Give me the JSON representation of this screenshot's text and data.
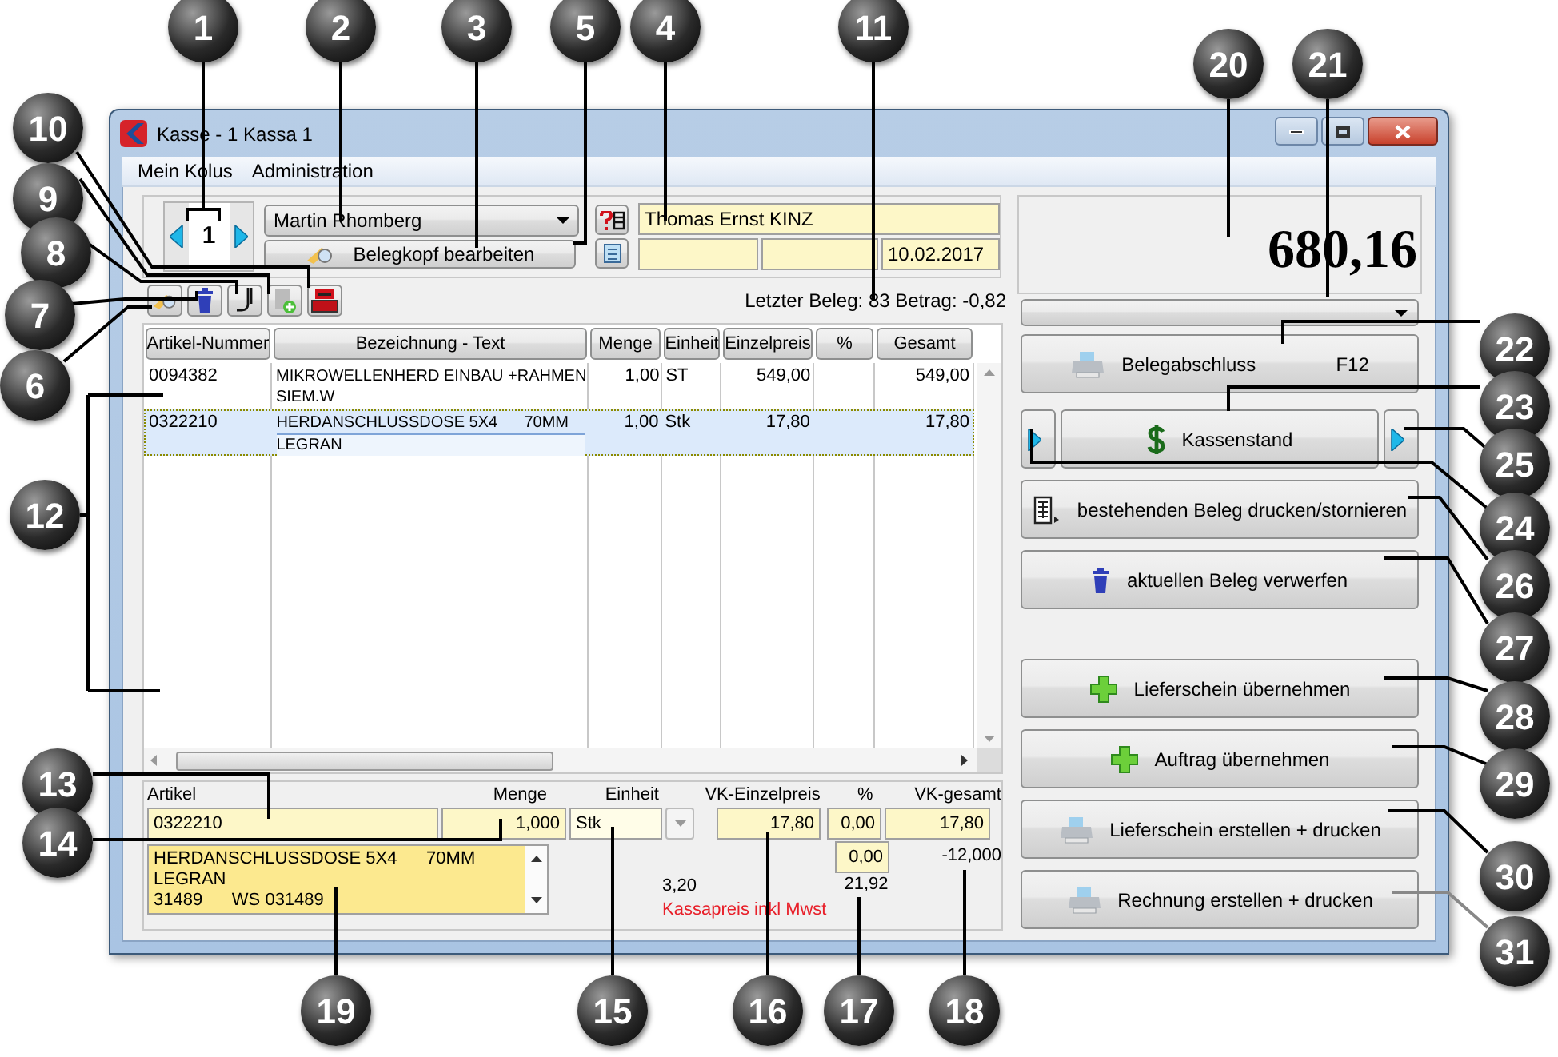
{
  "window": {
    "title": "Kasse - 1 Kassa 1"
  },
  "menu": [
    "Mein Kolus",
    "Administration"
  ],
  "header": {
    "page_number": "1",
    "salesperson": "Martin Rhomberg",
    "edit_button": "Belegkopf bearbeiten",
    "customer_name": "Thomas Ernst KINZ",
    "date": "10.02.2017"
  },
  "last_receipt": "Letzter Beleg: 83 Betrag: -0,82",
  "table": {
    "columns": [
      "Artikel-Nummer",
      "Bezeichnung - Text",
      "Menge",
      "Einheit",
      "Einzelpreis",
      "%",
      "Gesamt"
    ],
    "rows": [
      {
        "selected": false,
        "article": "0094382",
        "description": [
          "MIKROWELLENHERD EINBAU +RAHMEN",
          "SIEM.W"
        ],
        "quantity": "1,00",
        "unit": "ST",
        "unit_price": "549,00",
        "total": "549,00"
      },
      {
        "selected": true,
        "article": "0322210",
        "description": [
          "HERDANSCHLUSSDOSE 5X4      70MM",
          "LEGRAN"
        ],
        "quantity": "1,00",
        "unit": "Stk",
        "unit_price": "17,80",
        "total": "17,80"
      }
    ]
  },
  "entry": {
    "article_label": "Artikel",
    "article": "0322210",
    "quantity_label": "Menge",
    "quantity": "1,000",
    "unit_label": "Einheit",
    "unit": "Stk",
    "price_label": "VK-Einzelpreis",
    "price": "17,80",
    "percent_label": "%",
    "percent": "0,00",
    "total_label": "VK-gesamt",
    "total": "17,80",
    "percent_2": "0,00",
    "value_2": "-12,000",
    "notes": [
      "HERDANSCHLUSSDOSE 5X4      70MM",
      "LEGRAN",
      "31489      WS 031489"
    ],
    "value_3": "3,20",
    "value_4": "21,92",
    "price_note": "Kassapreis inkl Mwst"
  },
  "total": "680,16",
  "actions": [
    {
      "kind": "printer",
      "label": "Belegabschluss",
      "shortcut": "F12"
    },
    {
      "kind": "cash",
      "label": "Kassenstand"
    },
    {
      "kind": "document",
      "label": "bestehenden Beleg drucken/stornieren"
    },
    {
      "kind": "trash",
      "label": "aktuellen Beleg verwerfen"
    },
    {
      "kind": "plus",
      "label": "Lieferschein übernehmen"
    },
    {
      "kind": "plus",
      "label": "Auftrag übernehmen"
    },
    {
      "kind": "printer",
      "label": "Lieferschein erstellen + drucken"
    },
    {
      "kind": "printer",
      "label": "Rechnung erstellen + drucken"
    }
  ],
  "callouts": [
    "1",
    "2",
    "3",
    "5",
    "4",
    "11",
    "20",
    "21",
    "10",
    "9",
    "8",
    "7",
    "22",
    "6",
    "23",
    "25",
    "12",
    "24",
    "26",
    "27",
    "28",
    "13",
    "29",
    "14",
    "30",
    "31",
    "19",
    "15",
    "16",
    "17",
    "18"
  ]
}
